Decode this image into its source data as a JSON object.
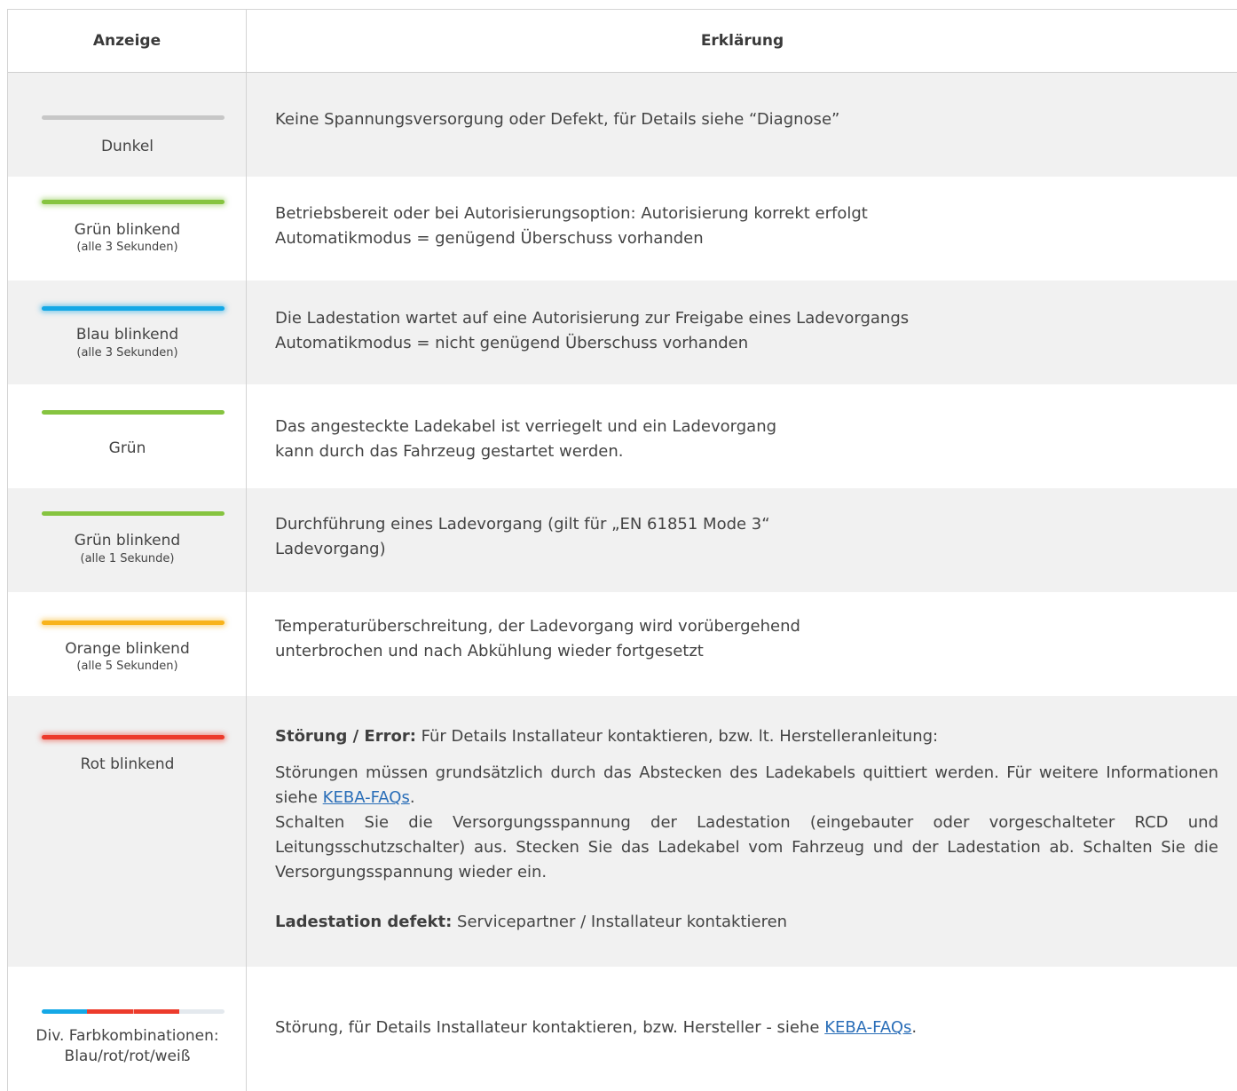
{
  "header": {
    "col_display": "Anzeige",
    "col_explanation": "Erklärung"
  },
  "colors": {
    "gray": "#c7c7c7",
    "green": "#86c440",
    "blue": "#14a8e6",
    "orange": "#f8b31c",
    "red": "#ec3b2c",
    "link": "#2a6eb8"
  },
  "rows": [
    {
      "label": "Dunkel",
      "sub": "",
      "led": "gray-bar",
      "lines": [
        "Keine Spannungsversorgung oder Defekt, für Details siehe “Diagnose”"
      ]
    },
    {
      "label": "Grün blinkend",
      "sub": "(alle 3 Sekunden)",
      "led": "green-glow-bar",
      "lines": [
        "Betriebsbereit oder bei Autorisierungsoption: Autorisierung korrekt erfolgt",
        "Automatikmodus = genügend Überschuss vorhanden"
      ]
    },
    {
      "label": "Blau blinkend",
      "sub": "(alle 3 Sekunden)",
      "led": "blue-glow-bar",
      "lines": [
        "Die Ladestation wartet auf eine Autorisierung zur Freigabe eines Ladevorgangs",
        "Automatikmodus = nicht genügend Überschuss vorhanden"
      ]
    },
    {
      "label": "Grün",
      "sub": "",
      "led": "green-bar",
      "lines": [
        "Das angesteckte Ladekabel ist verriegelt und ein Ladevorgang",
        "kann durch das Fahrzeug gestartet werden."
      ]
    },
    {
      "label": "Grün blinkend",
      "sub": "(alle 1 Sekunde)",
      "led": "green-bar",
      "lines": [
        "Durchführung eines Ladevorgang (gilt für „EN 61851 Mode 3“",
        "Ladevorgang)"
      ]
    },
    {
      "label": "Orange blinkend",
      "sub": "(alle 5 Sekunden)",
      "led": "orange-glow-bar",
      "lines": [
        "Temperaturüberschreitung, der Ladevorgang wird vorübergehend",
        "unterbrochen und nach Abkühlung wieder fortgesetzt"
      ]
    },
    {
      "label": "Rot blinkend",
      "sub": "",
      "led": "red-glow-bar",
      "error_title": "Störung / Error:",
      "error_text": " Für Details Installateur kontaktieren, bzw. lt. Herstelleranleitung:",
      "para1": "Störungen müssen grundsätzlich durch das Abstecken des Ladekabels quittiert werden. Für weitere Informationen siehe ",
      "para1_link": "KEBA-FAQs",
      "para1_end": ".",
      "para2": "Schalten Sie die Versorgungsspannung der Ladestation (eingebauter oder vorgeschalteter RCD und Leitungsschutzschalter) aus. Stecken Sie das Ladekabel vom Fahrzeug und der Ladestation ab. Schalten Sie die Versorgungsspannung wieder ein.",
      "defect_title": "Ladestation defekt:",
      "defect_text": " Servicepartner / Installateur kontaktieren"
    },
    {
      "label": "Div. Farbkombinationen:",
      "sub": "Blau/rot/rot/weiß",
      "led": "multi-color-bar",
      "text": "Störung, für Details Installateur kontaktieren, bzw. Hersteller - siehe ",
      "link": "KEBA-FAQs",
      "end": "."
    }
  ]
}
